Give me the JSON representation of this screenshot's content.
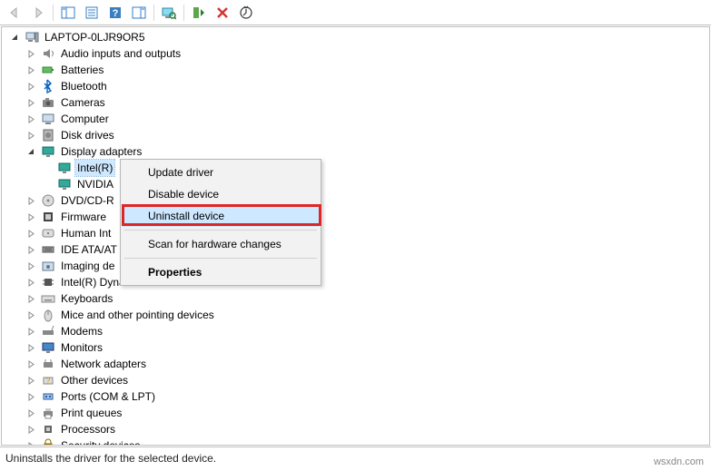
{
  "root": {
    "label": "LAPTOP-0LJR9OR5"
  },
  "categories": [
    {
      "label": "Audio inputs and outputs",
      "expanded": false,
      "icon": "audio"
    },
    {
      "label": "Batteries",
      "expanded": false,
      "icon": "battery"
    },
    {
      "label": "Bluetooth",
      "expanded": false,
      "icon": "bluetooth"
    },
    {
      "label": "Cameras",
      "expanded": false,
      "icon": "camera"
    },
    {
      "label": "Computer",
      "expanded": false,
      "icon": "computer"
    },
    {
      "label": "Disk drives",
      "expanded": false,
      "icon": "disk"
    },
    {
      "label": "Display adapters",
      "expanded": true,
      "icon": "display",
      "children": [
        {
          "label": "Intel(R)",
          "icon": "display",
          "selected": true,
          "truncated": true
        },
        {
          "label": "NVIDIA",
          "icon": "display",
          "truncated": true
        }
      ]
    },
    {
      "label": "DVD/CD-R",
      "expanded": false,
      "icon": "dvd",
      "truncated": true
    },
    {
      "label": "Firmware",
      "expanded": false,
      "icon": "firmware",
      "truncated": true
    },
    {
      "label": "Human Int",
      "expanded": false,
      "icon": "hid",
      "truncated": true
    },
    {
      "label": "IDE ATA/AT",
      "expanded": false,
      "icon": "ide",
      "truncated": true
    },
    {
      "label": "Imaging de",
      "expanded": false,
      "icon": "imaging",
      "truncated": true
    },
    {
      "label": "Intel(R) Dynamic Platform and Thermal Framework",
      "expanded": false,
      "icon": "chip"
    },
    {
      "label": "Keyboards",
      "expanded": false,
      "icon": "keyboard"
    },
    {
      "label": "Mice and other pointing devices",
      "expanded": false,
      "icon": "mouse"
    },
    {
      "label": "Modems",
      "expanded": false,
      "icon": "modem"
    },
    {
      "label": "Monitors",
      "expanded": false,
      "icon": "monitor"
    },
    {
      "label": "Network adapters",
      "expanded": false,
      "icon": "network"
    },
    {
      "label": "Other devices",
      "expanded": false,
      "icon": "other"
    },
    {
      "label": "Ports (COM & LPT)",
      "expanded": false,
      "icon": "port"
    },
    {
      "label": "Print queues",
      "expanded": false,
      "icon": "printer"
    },
    {
      "label": "Processors",
      "expanded": false,
      "icon": "cpu"
    },
    {
      "label": "Security devices",
      "expanded": false,
      "icon": "security"
    }
  ],
  "context_menu": {
    "items": [
      {
        "label": "Update driver"
      },
      {
        "label": "Disable device"
      },
      {
        "label": "Uninstall device",
        "highlight": true,
        "hover": true
      },
      {
        "sep": true
      },
      {
        "label": "Scan for hardware changes"
      },
      {
        "sep": true
      },
      {
        "label": "Properties",
        "bold": true
      }
    ]
  },
  "statusbar": {
    "text": "Uninstalls the driver for the selected device."
  },
  "watermark": "wsxdn.com"
}
